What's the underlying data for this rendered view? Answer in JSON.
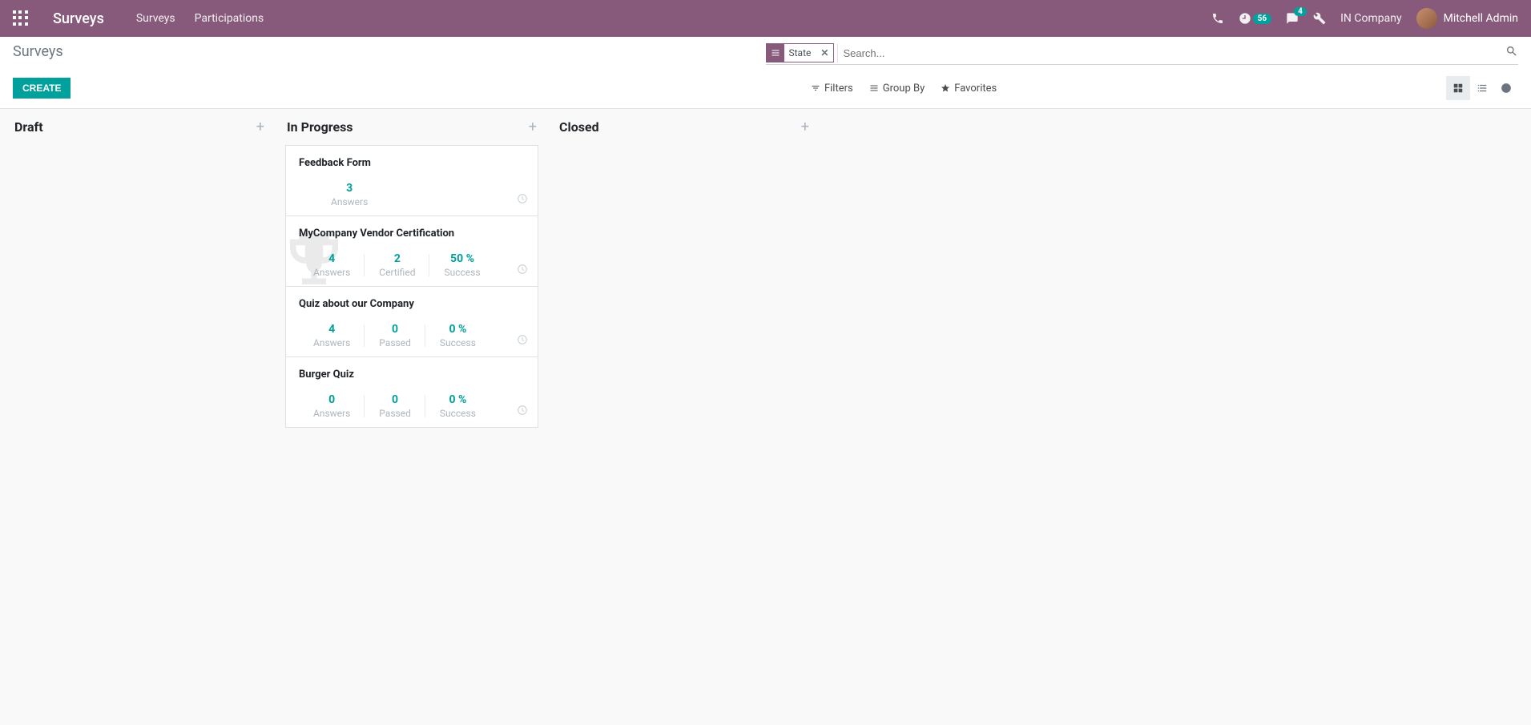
{
  "navbar": {
    "brand": "Surveys",
    "menu": {
      "surveys": "Surveys",
      "participations": "Participations"
    },
    "activities_count": "56",
    "messages_count": "4",
    "company": "IN Company",
    "user": "Mitchell Admin"
  },
  "control": {
    "breadcrumb": "Surveys",
    "create_label": "CREATE",
    "search_facet": "State",
    "search_placeholder": "Search...",
    "filters_label": "Filters",
    "groupby_label": "Group By",
    "favorites_label": "Favorites"
  },
  "kanban": {
    "columns": {
      "draft": {
        "title": "Draft"
      },
      "in_progress": {
        "title": "In Progress"
      },
      "closed": {
        "title": "Closed"
      }
    },
    "cards": {
      "c0": {
        "title": "Feedback Form",
        "stats": {
          "s0": {
            "value": "3",
            "label": "Answers"
          }
        }
      },
      "c1": {
        "title": "MyCompany Vendor Certification",
        "stats": {
          "s0": {
            "value": "4",
            "label": "Answers"
          },
          "s1": {
            "value": "2",
            "label": "Certified"
          },
          "s2": {
            "value": "50 %",
            "label": "Success"
          }
        }
      },
      "c2": {
        "title": "Quiz about our Company",
        "stats": {
          "s0": {
            "value": "4",
            "label": "Answers"
          },
          "s1": {
            "value": "0",
            "label": "Passed"
          },
          "s2": {
            "value": "0 %",
            "label": "Success"
          }
        }
      },
      "c3": {
        "title": "Burger Quiz",
        "stats": {
          "s0": {
            "value": "0",
            "label": "Answers"
          },
          "s1": {
            "value": "0",
            "label": "Passed"
          },
          "s2": {
            "value": "0 %",
            "label": "Success"
          }
        }
      }
    }
  }
}
